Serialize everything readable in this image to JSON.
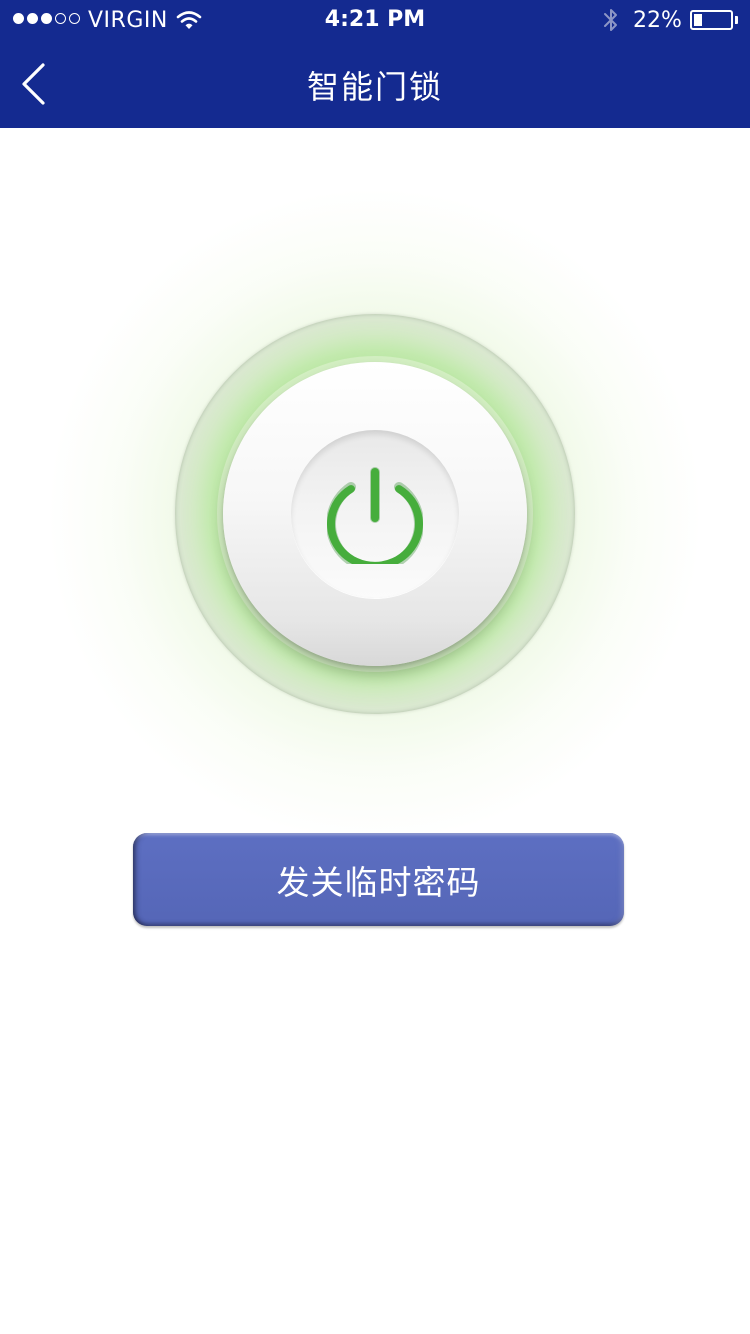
{
  "status_bar": {
    "signal_bars": [
      true,
      true,
      true,
      false,
      false
    ],
    "carrier": "VIRGIN",
    "wifi_icon": "wifi-icon",
    "time": "4:21 PM",
    "bluetooth_icon": "bluetooth-icon",
    "battery_percent": "22%",
    "battery_level": 0.22
  },
  "header": {
    "back_icon": "chevron-left-icon",
    "title": "智能门锁",
    "background_color": "#142a90"
  },
  "main": {
    "power_button_icon": "power-icon",
    "power_icon_color": "#46ad3c",
    "send_password_label": "发关临时密码",
    "button_color": "#5566b7"
  }
}
